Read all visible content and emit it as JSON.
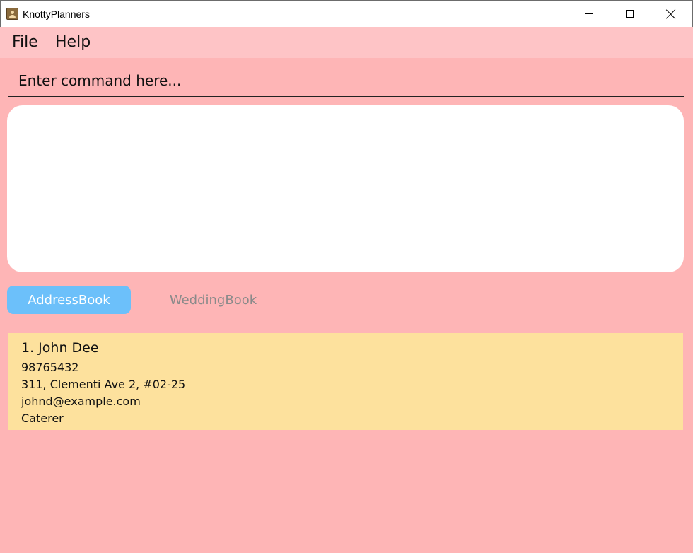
{
  "window": {
    "title": "KnottyPlanners",
    "icon": "address-book-app-icon"
  },
  "menu": {
    "items": [
      "File",
      "Help"
    ]
  },
  "command": {
    "placeholder": "Enter command here...",
    "value": ""
  },
  "result": {
    "text": ""
  },
  "tabs": [
    {
      "label": "AddressBook",
      "selected": true
    },
    {
      "label": "WeddingBook",
      "selected": false
    }
  ],
  "contacts": [
    {
      "index_name": "1. John Dee",
      "phone": "98765432",
      "address": "311, Clementi Ave 2, #02-25",
      "email": "johnd@example.com",
      "tag": "Caterer"
    }
  ],
  "colors": {
    "background": "#feb5b6",
    "menubar": "#fec4c6",
    "selected_tab": "#6cc0fa",
    "card": "#fde19d"
  }
}
